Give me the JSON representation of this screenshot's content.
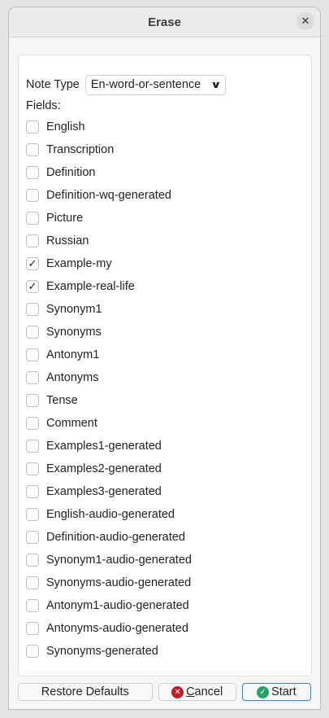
{
  "window": {
    "title": "Erase",
    "close": "✕"
  },
  "note_type": {
    "label": "Note Type",
    "value": "En-word-or-sentence"
  },
  "fields_label": "Fields:",
  "fields": [
    {
      "label": "English",
      "checked": false
    },
    {
      "label": "Transcription",
      "checked": false
    },
    {
      "label": "Definition",
      "checked": false
    },
    {
      "label": "Definition-wq-generated",
      "checked": false
    },
    {
      "label": "Picture",
      "checked": false
    },
    {
      "label": "Russian",
      "checked": false
    },
    {
      "label": "Example-my",
      "checked": true
    },
    {
      "label": "Example-real-life",
      "checked": true
    },
    {
      "label": "Synonym1",
      "checked": false
    },
    {
      "label": "Synonyms",
      "checked": false
    },
    {
      "label": "Antonym1",
      "checked": false
    },
    {
      "label": "Antonyms",
      "checked": false
    },
    {
      "label": "Tense",
      "checked": false
    },
    {
      "label": "Comment",
      "checked": false
    },
    {
      "label": "Examples1-generated",
      "checked": false
    },
    {
      "label": "Examples2-generated",
      "checked": false
    },
    {
      "label": "Examples3-generated",
      "checked": false
    },
    {
      "label": "English-audio-generated",
      "checked": false
    },
    {
      "label": "Definition-audio-generated",
      "checked": false
    },
    {
      "label": "Synonym1-audio-generated",
      "checked": false
    },
    {
      "label": "Synonyms-audio-generated",
      "checked": false
    },
    {
      "label": "Antonym1-audio-generated",
      "checked": false
    },
    {
      "label": "Antonyms-audio-generated",
      "checked": false
    },
    {
      "label": "Synonyms-generated",
      "checked": false
    }
  ],
  "buttons": {
    "restore": "Restore Defaults",
    "cancel_first": "C",
    "cancel_rest": "ancel",
    "start": "Start"
  },
  "colors": {
    "cancel": "#c01c28",
    "start": "#26a269",
    "focus": "#3584e4"
  }
}
